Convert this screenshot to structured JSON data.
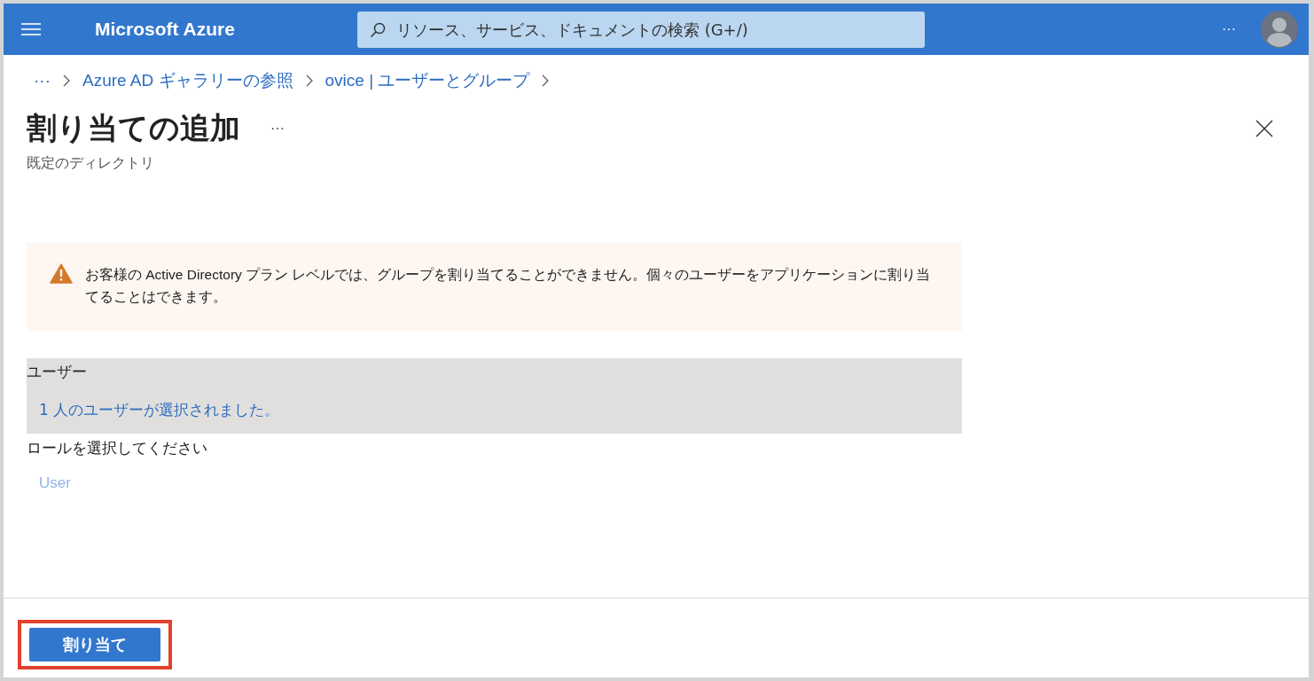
{
  "header": {
    "brand": "Microsoft Azure",
    "search": {
      "placeholder": "リソース、サービス、ドキュメントの検索 (G+/)"
    },
    "more": "···"
  },
  "breadcrumb": {
    "overflow": "···",
    "items": [
      "Azure AD ギャラリーの参照",
      "ovice | ユーザーとグループ"
    ]
  },
  "blade": {
    "title": "割り当ての追加",
    "more": "···",
    "subtitle": "既定のディレクトリ"
  },
  "warning": {
    "text": "お客様の Active Directory プラン レベルでは、グループを割り当てることができません。個々のユーザーをアプリケーションに割り当てることはできます。"
  },
  "users": {
    "label": "ユーザー",
    "value": "1 人のユーザーが選択されました。"
  },
  "role": {
    "label": "ロールを選択してください",
    "value": "User"
  },
  "footer": {
    "assign_button": {
      "label": "割り当て",
      "highlighted": true
    }
  }
}
